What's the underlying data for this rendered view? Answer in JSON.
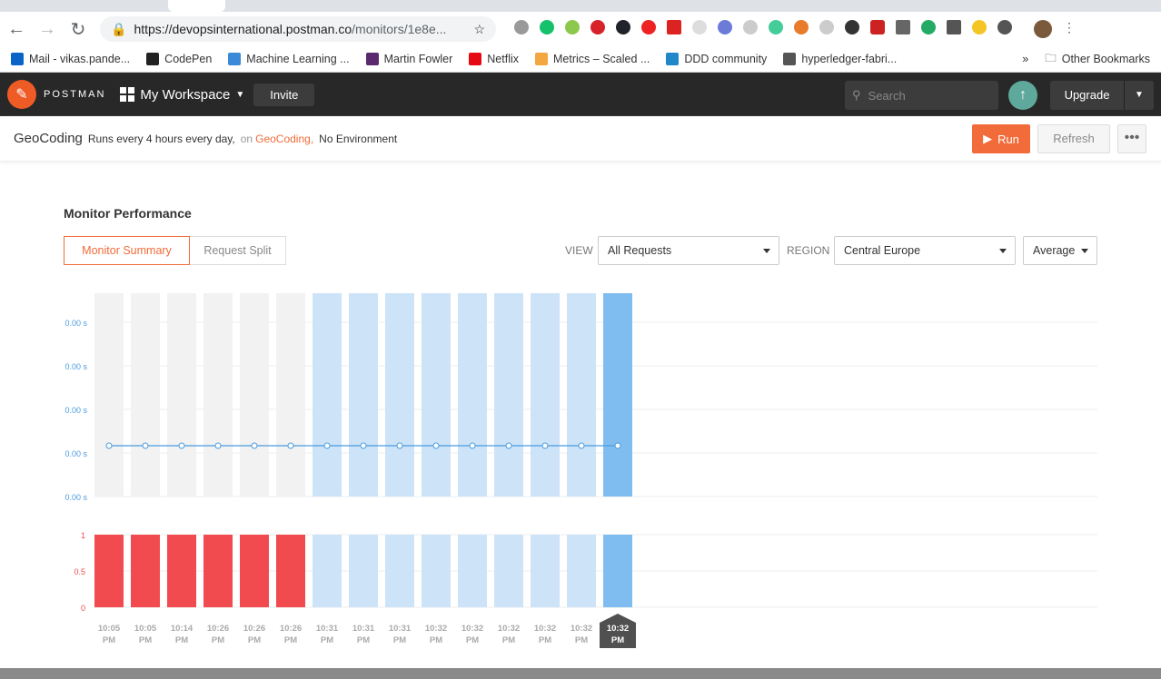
{
  "browser": {
    "url_host": "https://devopsinternational.postman.co",
    "url_path": "/monitors/1e8e...",
    "bookmarks": [
      {
        "label": "Mail - vikas.pande...",
        "color": "#0a64c8"
      },
      {
        "label": "CodePen",
        "color": "#222"
      },
      {
        "label": "Machine Learning ...",
        "color": "#3b8ad8"
      },
      {
        "label": "Martin Fowler",
        "color": "#5b2a6e"
      },
      {
        "label": "Netflix",
        "color": "#e50914"
      },
      {
        "label": "Metrics – Scaled ...",
        "color": "#f4a640"
      },
      {
        "label": "DDD community",
        "color": "#1e88c8"
      },
      {
        "label": "hyperledger-fabri...",
        "color": "#555"
      }
    ],
    "overflow": "»",
    "other_bookmarks": "Other Bookmarks"
  },
  "app": {
    "brand": "POSTMAN",
    "workspace": "My Workspace",
    "invite": "Invite",
    "search_placeholder": "Search",
    "upgrade": "Upgrade"
  },
  "monitor": {
    "name": "GeoCoding",
    "schedule": "Runs every 4 hours every day,",
    "on": "on",
    "collection": "GeoCoding,",
    "environment": "No Environment",
    "run": "Run",
    "refresh": "Refresh",
    "more": "•••"
  },
  "performance": {
    "title": "Monitor Performance",
    "tabs": [
      {
        "label": "Monitor Summary",
        "active": true
      },
      {
        "label": "Request Split",
        "active": false
      }
    ],
    "view_label": "VIEW",
    "view_value": "All Requests",
    "region_label": "REGION",
    "region_value": "Central Europe",
    "metric_value": "Average"
  },
  "chart_data": [
    {
      "type": "line",
      "ylabel": "",
      "y_ticks": [
        "0.00 s",
        "0.00 s",
        "0.00 s",
        "0.00 s",
        "0.00 s"
      ],
      "categories": [
        "10:05 PM",
        "10:05 PM",
        "10:14 PM",
        "10:26 PM",
        "10:26 PM",
        "10:26 PM",
        "10:31 PM",
        "10:31 PM",
        "10:31 PM",
        "10:32 PM",
        "10:32 PM",
        "10:32 PM",
        "10:32 PM",
        "10:32 PM",
        "10:32 PM"
      ],
      "values": [
        0,
        0,
        0,
        0,
        0,
        0,
        0,
        0,
        0,
        0,
        0,
        0,
        0,
        0,
        0
      ],
      "line_color": "#4a9be0"
    },
    {
      "type": "bar",
      "y_ticks": [
        "1",
        "0.5",
        "0"
      ],
      "ylim": [
        0,
        1
      ],
      "failed": [
        1,
        1,
        1,
        1,
        1,
        1,
        0,
        0,
        0,
        0,
        0,
        0,
        0,
        0,
        0
      ],
      "failed_color": "#f24b4f",
      "passed_color": "#cde4f8",
      "selected_index": 14,
      "selected_color": "#7fbdf0"
    }
  ]
}
